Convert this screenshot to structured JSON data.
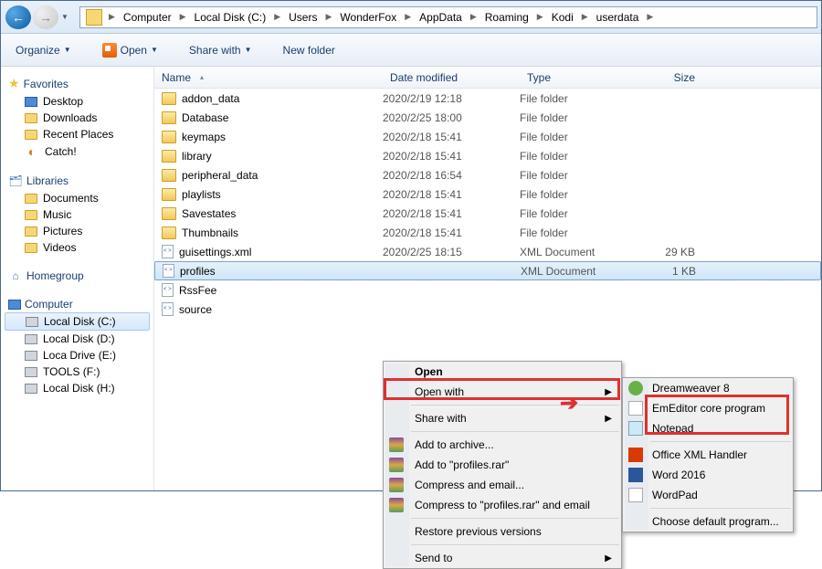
{
  "breadcrumbs": [
    "Computer",
    "Local Disk (C:)",
    "Users",
    "WonderFox",
    "AppData",
    "Roaming",
    "Kodi",
    "userdata"
  ],
  "toolbar": {
    "organize": "Organize",
    "open": "Open",
    "share": "Share with",
    "newfolder": "New folder"
  },
  "columns": {
    "name": "Name",
    "date": "Date modified",
    "type": "Type",
    "size": "Size"
  },
  "sidebar": {
    "favorites": "Favorites",
    "fav_items": [
      "Desktop",
      "Downloads",
      "Recent Places",
      "Catch!"
    ],
    "libraries": "Libraries",
    "lib_items": [
      "Documents",
      "Music",
      "Pictures",
      "Videos"
    ],
    "homegroup": "Homegroup",
    "computer": "Computer",
    "drives": [
      "Local Disk (C:)",
      "Local Disk (D:)",
      "Loca Drive (E:)",
      "TOOLS (F:)",
      "Local Disk (H:)"
    ]
  },
  "files": [
    {
      "name": "addon_data",
      "date": "2020/2/19 12:18",
      "type": "File folder",
      "size": "",
      "kind": "folder"
    },
    {
      "name": "Database",
      "date": "2020/2/25 18:00",
      "type": "File folder",
      "size": "",
      "kind": "folder"
    },
    {
      "name": "keymaps",
      "date": "2020/2/18 15:41",
      "type": "File folder",
      "size": "",
      "kind": "folder"
    },
    {
      "name": "library",
      "date": "2020/2/18 15:41",
      "type": "File folder",
      "size": "",
      "kind": "folder"
    },
    {
      "name": "peripheral_data",
      "date": "2020/2/18 16:54",
      "type": "File folder",
      "size": "",
      "kind": "folder"
    },
    {
      "name": "playlists",
      "date": "2020/2/18 15:41",
      "type": "File folder",
      "size": "",
      "kind": "folder"
    },
    {
      "name": "Savestates",
      "date": "2020/2/18 15:41",
      "type": "File folder",
      "size": "",
      "kind": "folder"
    },
    {
      "name": "Thumbnails",
      "date": "2020/2/18 15:41",
      "type": "File folder",
      "size": "",
      "kind": "folder"
    },
    {
      "name": "guisettings.xml",
      "date": "2020/2/25 18:15",
      "type": "XML Document",
      "size": "29 KB",
      "kind": "xml"
    },
    {
      "name": "profiles",
      "date": "",
      "type": "XML Document",
      "size": "1 KB",
      "kind": "xml",
      "selected": true
    },
    {
      "name": "RssFee",
      "date": "",
      "type": "",
      "size": "",
      "kind": "xml"
    },
    {
      "name": "source",
      "date": "",
      "type": "",
      "size": "",
      "kind": "xml"
    }
  ],
  "context": {
    "open": "Open",
    "openwith": "Open with",
    "sharewith": "Share with",
    "addarchive": "Add to archive...",
    "addprofiles": "Add to \"profiles.rar\"",
    "compressemail": "Compress and email...",
    "compressprofiles": "Compress to \"profiles.rar\" and email",
    "restore": "Restore previous versions",
    "sendto": "Send to"
  },
  "submenu": {
    "dreamweaver": "Dreamweaver 8",
    "emeditor": "EmEditor core program",
    "notepad": "Notepad",
    "officexml": "Office XML Handler",
    "word": "Word 2016",
    "wordpad": "WordPad",
    "choose": "Choose default program..."
  }
}
